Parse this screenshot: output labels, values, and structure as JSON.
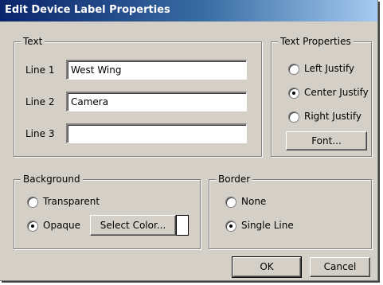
{
  "window": {
    "title": "Edit Device Label Properties"
  },
  "text_group": {
    "legend": "Text",
    "line1": {
      "label": "Line 1",
      "value": "West Wing"
    },
    "line2": {
      "label": "Line 2",
      "value": "Camera"
    },
    "line3": {
      "label": "Line 3",
      "value": ""
    }
  },
  "text_properties": {
    "legend": "Text Properties",
    "options": [
      {
        "label": "Left Justify",
        "selected": false
      },
      {
        "label": "Center Justify",
        "selected": true
      },
      {
        "label": "Right Justify",
        "selected": false
      }
    ],
    "font_button": "Font..."
  },
  "background": {
    "legend": "Background",
    "transparent_label": "Transparent",
    "opaque_label": "Opaque",
    "selected": "Opaque",
    "select_color_button": "Select Color...",
    "color": "#ffffff"
  },
  "border": {
    "legend": "Border",
    "none_label": "None",
    "single_line_label": "Single Line",
    "selected": "Single Line"
  },
  "buttons": {
    "ok": "OK",
    "cancel": "Cancel"
  }
}
